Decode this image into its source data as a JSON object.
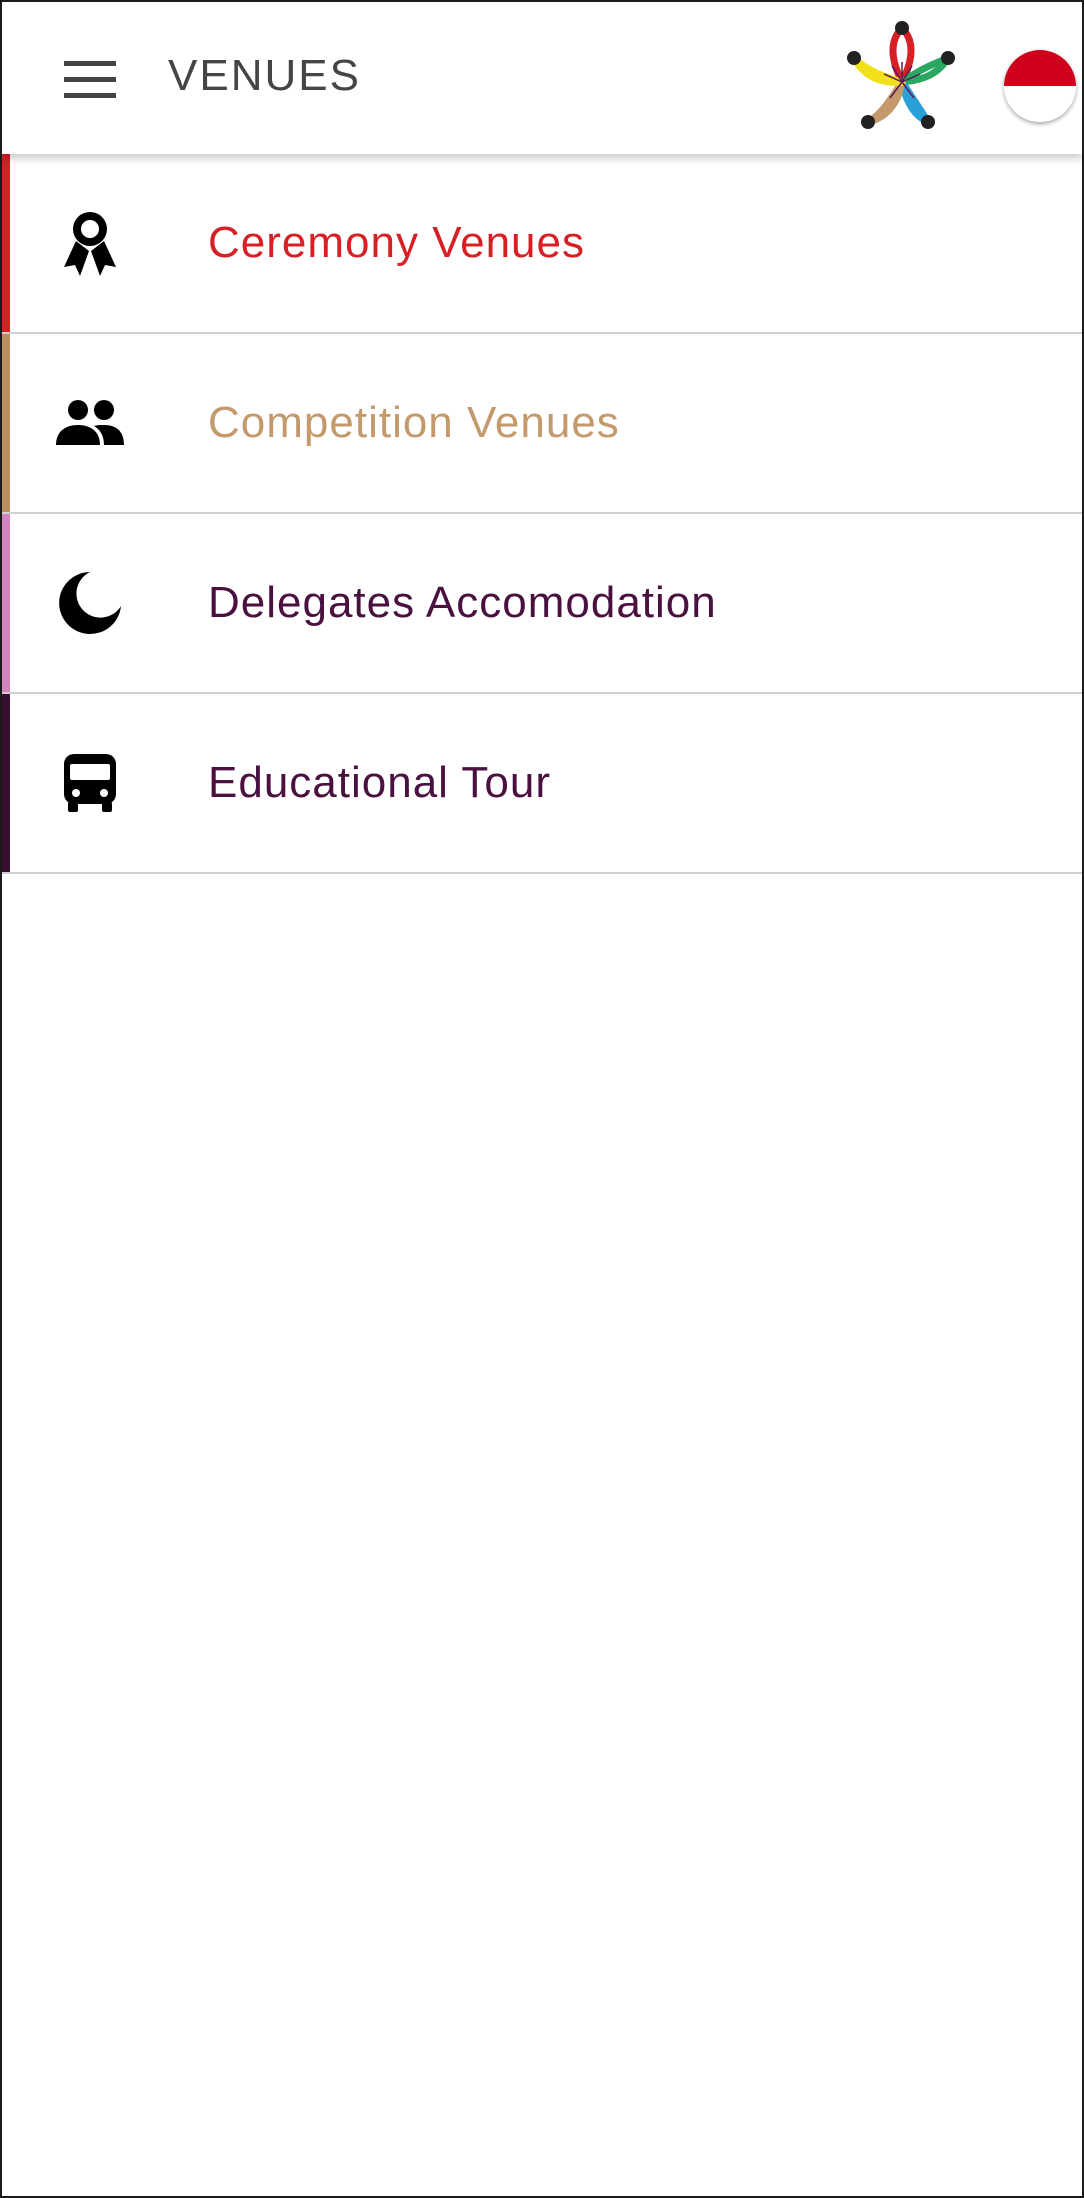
{
  "header": {
    "title": "VENUES",
    "menu_icon": "hamburger-menu-icon",
    "logo": "flower-logo",
    "language_flag": "indonesia-flag",
    "flag_colors": {
      "top": "#d0021b",
      "bottom": "#ffffff"
    }
  },
  "venues": [
    {
      "label": "Ceremony Venues",
      "icon": "ribbon-award-icon",
      "color": "#d71f26",
      "stripe": "#d71f26"
    },
    {
      "label": "Competition Venues",
      "icon": "people-group-icon",
      "color": "#c49a6c",
      "stripe": "#b8905e"
    },
    {
      "label": "Delegates Accomodation",
      "icon": "moon-icon",
      "color": "#4a1040",
      "stripe": "#d485c0"
    },
    {
      "label": "Educational Tour",
      "icon": "bus-icon",
      "color": "#4a1040",
      "stripe": "#3a0d33"
    }
  ]
}
